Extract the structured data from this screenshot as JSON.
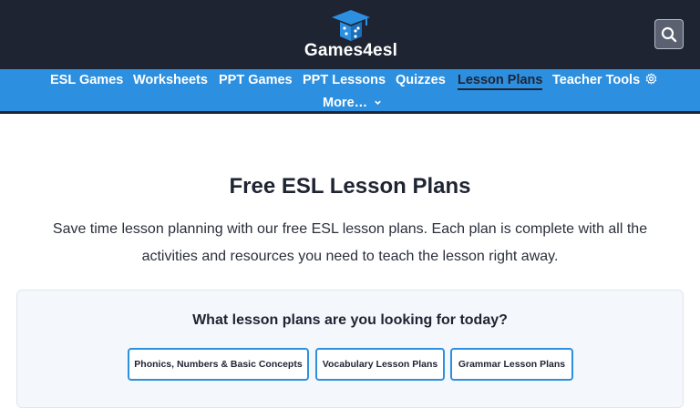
{
  "header": {
    "logo_text": "Games4esl",
    "search_icon": "search-icon"
  },
  "nav": {
    "items": [
      {
        "label": "ESL Games"
      },
      {
        "label": "Worksheets"
      },
      {
        "label": "PPT Games"
      },
      {
        "label": "PPT Lessons"
      },
      {
        "label": "Quizzes"
      },
      {
        "label": "Lesson Plans"
      },
      {
        "label": "Teacher Tools"
      }
    ],
    "active": "Lesson Plans",
    "more_label": "More…",
    "teacher_tools_icon": "gear-icon"
  },
  "main": {
    "title": "Free ESL Lesson Plans",
    "intro": "Save time lesson planning with our free ESL lesson plans. Each plan is complete with all the activities and resources you need to teach the lesson right away."
  },
  "finder": {
    "question": "What lesson plans are you looking for today?",
    "options": [
      {
        "label": "Phonics, Numbers & Basic Concepts"
      },
      {
        "label": "Vocabulary Lesson Plans"
      },
      {
        "label": "Grammar Lesson Plans"
      }
    ]
  },
  "colors": {
    "header_bg": "#1f2433",
    "nav_bg": "#2d8fe0",
    "accent": "#2d8fe0"
  }
}
